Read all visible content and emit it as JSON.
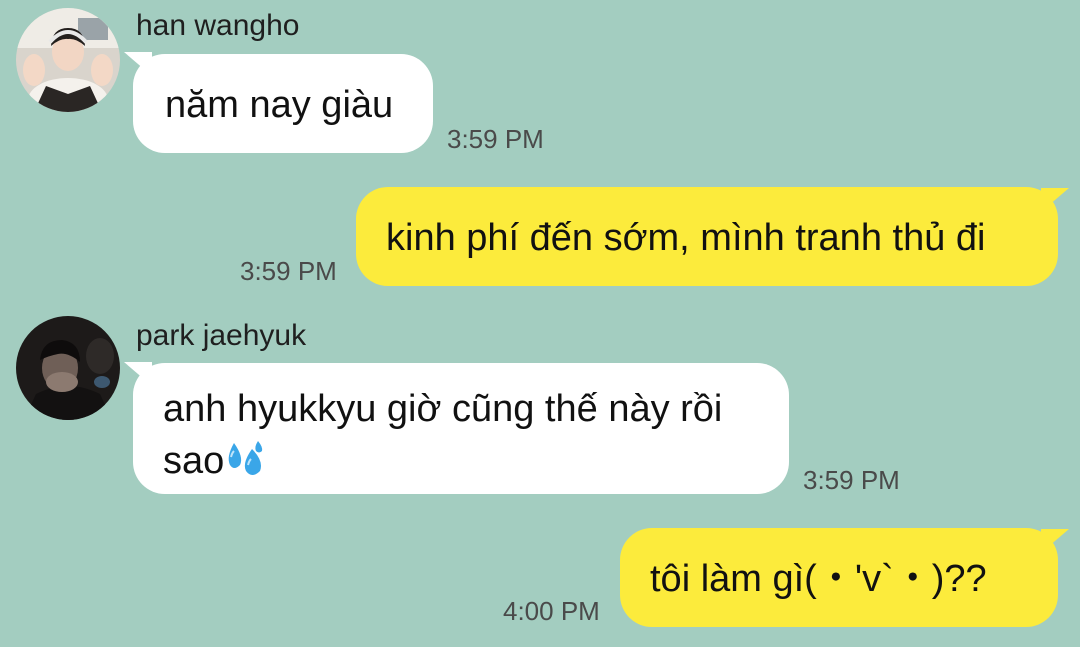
{
  "messages": [
    {
      "sender": "han wangho",
      "text": "năm nay giàu",
      "time": "3:59 PM"
    },
    {
      "text": "kinh phí đến sớm, mình tranh thủ đi",
      "time": "3:59 PM"
    },
    {
      "sender": "park jaehyuk",
      "text_line1": "anh hyukkyu giờ cũng thế này rồi",
      "text_line2": "sao",
      "emoji": "sweat-droplets-icon",
      "time": "3:59 PM"
    },
    {
      "text": "tôi làm gì(・'v`・)??",
      "time": "4:00 PM"
    }
  ],
  "colors": {
    "background": "#a3cdc0",
    "incoming_bubble": "#ffffff",
    "outgoing_bubble": "#fceb3c",
    "timestamp": "#4a4a4a"
  }
}
